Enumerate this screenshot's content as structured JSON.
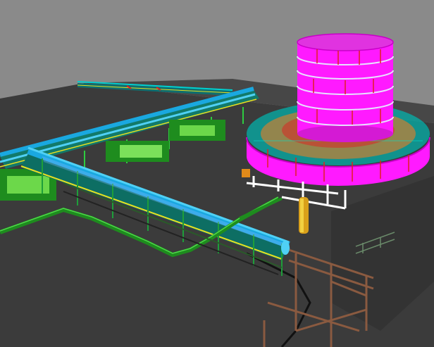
{
  "viewport": {
    "background_color": "#8a8a8a",
    "ground_color": "#3b3b3b"
  },
  "colors": {
    "pipe": "#1aa8e0",
    "pipe_light": "#4fd0f5",
    "green_pipe": "#1e8c1e",
    "green_dark": "#0f5e12",
    "magenta_tank": "#ff1aff",
    "magenta_dark": "#c800c8",
    "cyan_struct": "#00e5d0",
    "yellow": "#e8e020",
    "orange": "#d98a1a",
    "brown_frame": "#8a5a40",
    "red": "#e02020",
    "white": "#ffffff",
    "dark_steel": "#222222"
  },
  "icons": [
    "cooling-tower",
    "tank-ring",
    "pipe-rack",
    "steel-frame",
    "vessel",
    "ductwork"
  ]
}
